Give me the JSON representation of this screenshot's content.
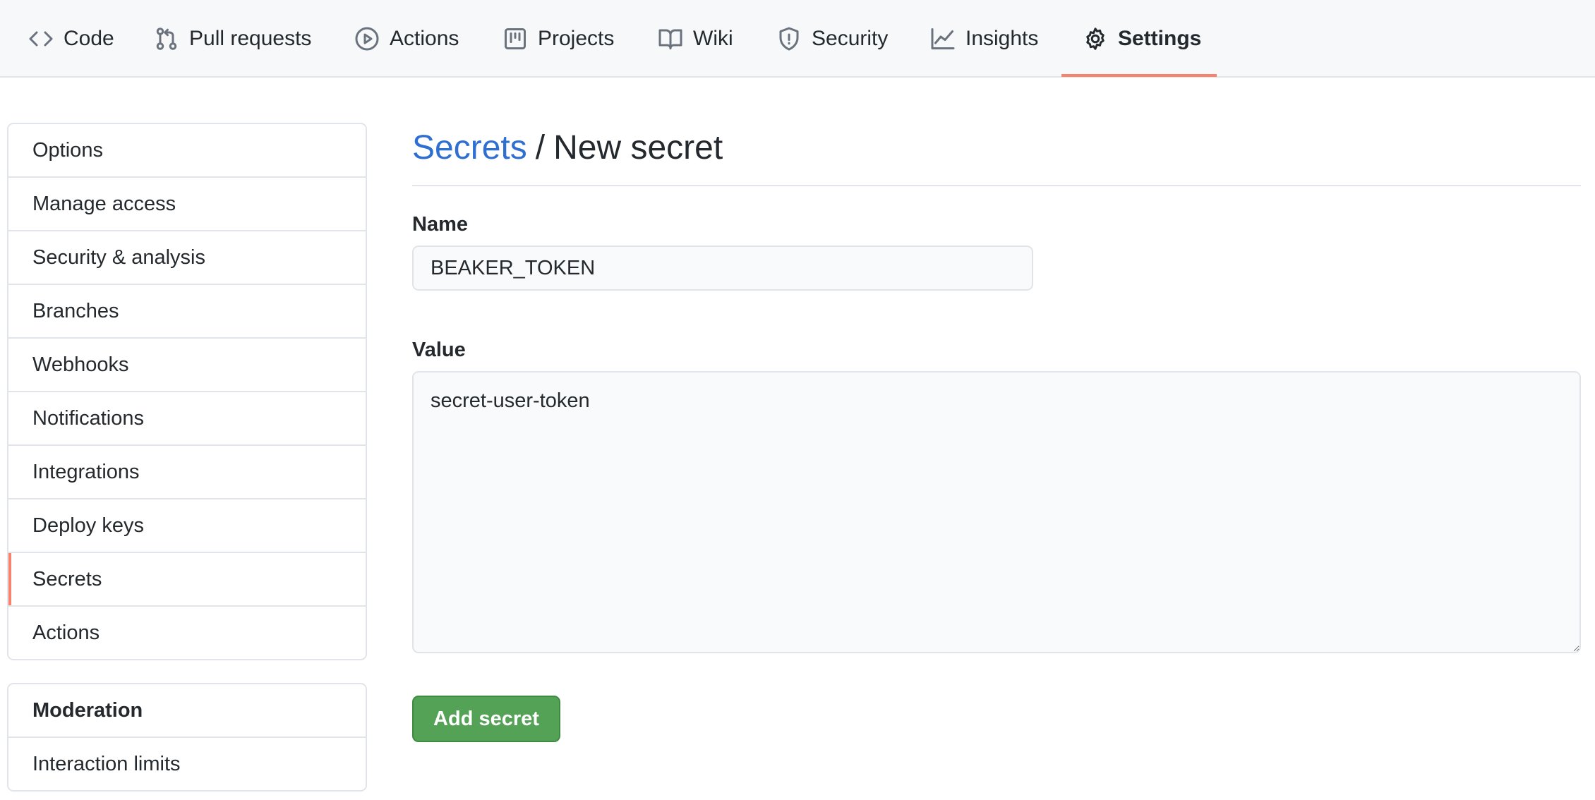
{
  "repo_nav": {
    "tabs": [
      {
        "label": "Code",
        "icon": "code-icon"
      },
      {
        "label": "Pull requests",
        "icon": "pull-request-icon"
      },
      {
        "label": "Actions",
        "icon": "play-icon"
      },
      {
        "label": "Projects",
        "icon": "project-icon"
      },
      {
        "label": "Wiki",
        "icon": "book-icon"
      },
      {
        "label": "Security",
        "icon": "shield-icon"
      },
      {
        "label": "Insights",
        "icon": "graph-icon"
      },
      {
        "label": "Settings",
        "icon": "gear-icon",
        "selected": true
      }
    ],
    "accent_color": "#f9826c"
  },
  "sidebar": {
    "items": [
      {
        "label": "Options"
      },
      {
        "label": "Manage access"
      },
      {
        "label": "Security & analysis"
      },
      {
        "label": "Branches"
      },
      {
        "label": "Webhooks"
      },
      {
        "label": "Notifications"
      },
      {
        "label": "Integrations"
      },
      {
        "label": "Deploy keys"
      },
      {
        "label": "Secrets",
        "selected": true
      },
      {
        "label": "Actions"
      }
    ],
    "moderation": {
      "heading": "Moderation",
      "items": [
        {
          "label": "Interaction limits"
        }
      ]
    }
  },
  "main": {
    "breadcrumb_link": "Secrets",
    "separator": "/",
    "title": "New secret",
    "name_label": "Name",
    "name_value": "BEAKER_TOKEN",
    "value_label": "Value",
    "value_value": "secret-user-token",
    "submit_label": "Add secret",
    "link_color": "#2f6fd1",
    "button_color": "#54a256"
  }
}
